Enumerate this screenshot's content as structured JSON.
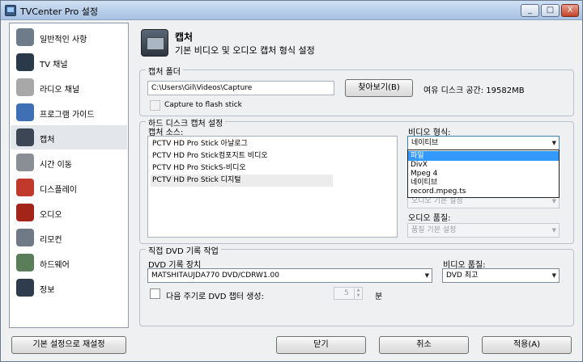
{
  "window": {
    "title": "TVCenter Pro 설정",
    "minimize": "_",
    "maximize": "□",
    "close": "X"
  },
  "sidebar": {
    "items": [
      {
        "label": "일반적인 사항",
        "icon": "settings-icon",
        "color": "#6d7b8a"
      },
      {
        "label": "TV 채널",
        "icon": "tv-icon",
        "color": "#2b3a4a"
      },
      {
        "label": "라디오 채널",
        "icon": "radio-icon",
        "color": "#a8a8a8"
      },
      {
        "label": "프로그램 가이드",
        "icon": "guide-icon",
        "color": "#3f6fb5"
      },
      {
        "label": "캡처",
        "icon": "capture-icon",
        "color": "#3c4654"
      },
      {
        "label": "시간 이동",
        "icon": "timeshift-icon",
        "color": "#8a8f96"
      },
      {
        "label": "디스플레이",
        "icon": "display-icon",
        "color": "#c0392b"
      },
      {
        "label": "오디오",
        "icon": "audio-icon",
        "color": "#a32418"
      },
      {
        "label": "리모컨",
        "icon": "remote-icon",
        "color": "#707a86"
      },
      {
        "label": "하드웨어",
        "icon": "hardware-icon",
        "color": "#5a7d5a"
      },
      {
        "label": "정보",
        "icon": "info-icon",
        "color": "#2f3c4e"
      }
    ],
    "active_index": 4
  },
  "header": {
    "title": "캡처",
    "subtitle": "기본 비디오 및 오디오 캡처 형식 설정"
  },
  "capture_folder": {
    "legend": "캡처 폴더",
    "path": "C:\\Users\\Gil\\Videos\\Capture",
    "browse_label": "찾아보기(B)",
    "free_space": "여유 디스크 공간: 19582MB",
    "flash_label": "Capture to flash stick"
  },
  "hdd_capture": {
    "legend": "하드 디스크 캡처 설정",
    "source_label": "캡처 소스:",
    "sources": [
      "PCTV HD Pro Stick 아날로그",
      "PCTV HD Pro Stick컴포지트 비디오",
      "PCTV HD Pro StickS-비디오",
      "PCTV HD Pro Stick 디지털"
    ],
    "selected_source": 3,
    "video_format_label": "비디오 형식:",
    "video_format_value": "네이티브",
    "video_format_options": [
      "파일",
      "DivX",
      "Mpeg 4",
      "네이티브",
      "record.mpeg.ts"
    ],
    "highlighted_option": 0,
    "video_quality_value": "오디오 기본 설정",
    "audio_quality_label": "오디오 품질:",
    "audio_quality_value": "품질 기본 설정"
  },
  "dvd": {
    "legend": "직접 DVD 기록 작업",
    "device_label": "DVD 기록 장치",
    "device_value": "MATSHITAUJDA770 DVD/CDRW1.00",
    "quality_label": "비디오 품질:",
    "quality_value": "DVD 최고",
    "chapter_label": "다음 주기로 DVD 챕터 생성:",
    "chapter_value": "5",
    "chapter_unit": "분"
  },
  "footer": {
    "reset_label": "기본 설정으로 재설정",
    "close_label": "닫기",
    "cancel_label": "취소",
    "apply_label": "적용(A)"
  }
}
